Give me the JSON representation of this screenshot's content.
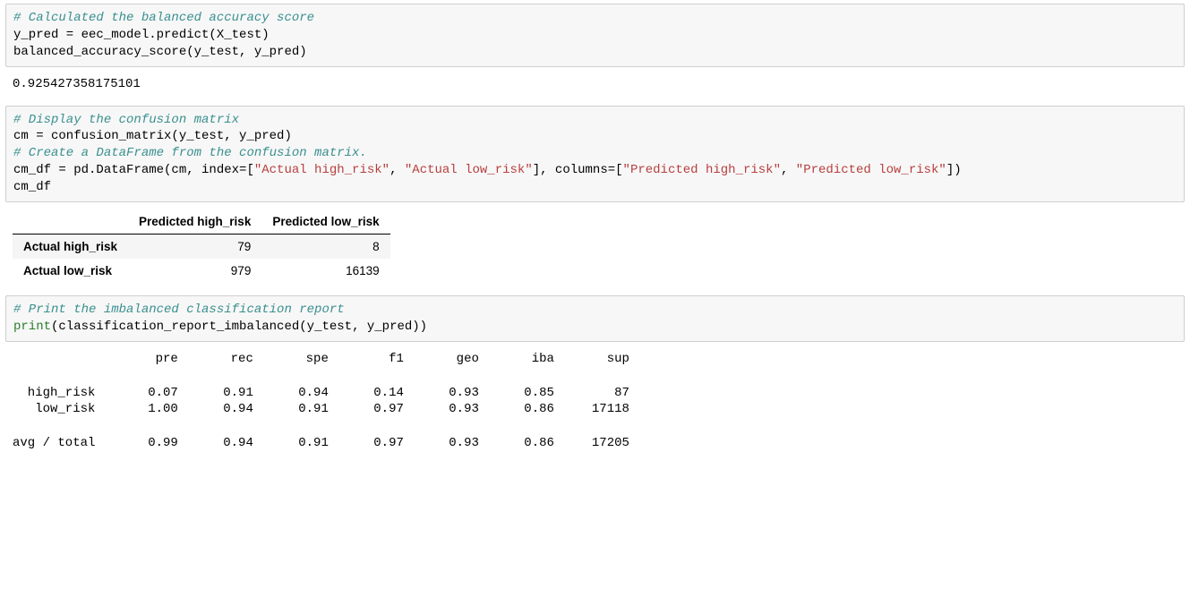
{
  "cell1": {
    "comment": "# Calculated the balanced accuracy score",
    "line2": "y_pred = eec_model.predict(X_test)",
    "line3": "balanced_accuracy_score(y_test, y_pred)"
  },
  "output1": "0.925427358175101",
  "cell2": {
    "comment1": "# Display the confusion matrix",
    "line2": "cm = confusion_matrix(y_test, y_pred)",
    "comment2": "# Create a DataFrame from the confusion matrix.",
    "line4_a": "cm_df = pd.DataFrame(cm, index=[",
    "str1": "\"Actual high_risk\"",
    "sep1": ", ",
    "str2": "\"Actual low_risk\"",
    "line4_b": "], columns=[",
    "str3": "\"Predicted high_risk\"",
    "sep2": ", ",
    "str4": "\"Predicted low_risk\"",
    "line4_c": "])",
    "line5": "cm_df"
  },
  "cm_table": {
    "col1": "Predicted high_risk",
    "col2": "Predicted low_risk",
    "row1hdr": "Actual high_risk",
    "r1c1": "79",
    "r1c2": "8",
    "row2hdr": "Actual low_risk",
    "r2c1": "979",
    "r2c2": "16139"
  },
  "cell3": {
    "comment": "# Print the imbalanced classification report",
    "print_kw": "print",
    "call": "(classification_report_imbalanced(y_test, y_pred))"
  },
  "report": "                   pre       rec       spe        f1       geo       iba       sup\n\n  high_risk       0.07      0.91      0.94      0.14      0.93      0.85        87\n   low_risk       1.00      0.94      0.91      0.97      0.93      0.86     17118\n\navg / total       0.99      0.94      0.91      0.97      0.93      0.86     17205",
  "chart_data": [
    {
      "type": "table",
      "title": "Confusion Matrix",
      "columns": [
        "Predicted high_risk",
        "Predicted low_risk"
      ],
      "rows": [
        "Actual high_risk",
        "Actual low_risk"
      ],
      "values": [
        [
          79,
          8
        ],
        [
          979,
          16139
        ]
      ]
    },
    {
      "type": "table",
      "title": "Imbalanced Classification Report",
      "columns": [
        "pre",
        "rec",
        "spe",
        "f1",
        "geo",
        "iba",
        "sup"
      ],
      "rows": [
        "high_risk",
        "low_risk",
        "avg / total"
      ],
      "values": [
        [
          0.07,
          0.91,
          0.94,
          0.14,
          0.93,
          0.85,
          87
        ],
        [
          1.0,
          0.94,
          0.91,
          0.97,
          0.93,
          0.86,
          17118
        ],
        [
          0.99,
          0.94,
          0.91,
          0.97,
          0.93,
          0.86,
          17205
        ]
      ]
    }
  ]
}
